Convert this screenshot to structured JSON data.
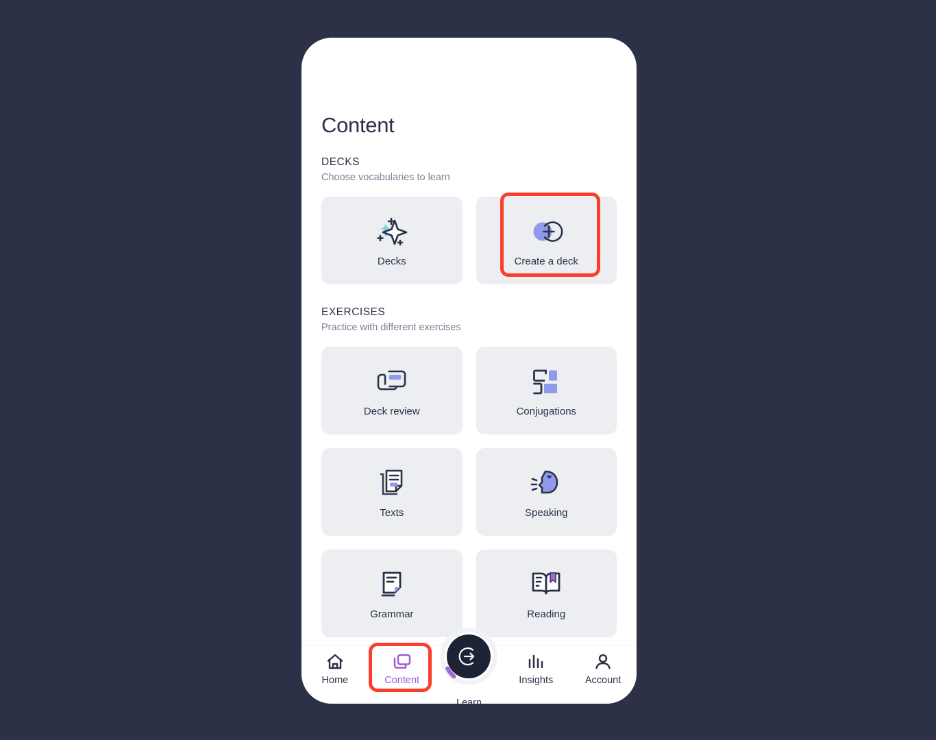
{
  "theme": {
    "page_background": "#2d3148",
    "phone_background": "#ffffff",
    "card_background": "#edeef2",
    "text_primary": "#2d3148",
    "text_secondary": "#7b7f93",
    "accent_purple": "#9b59d0",
    "accent_periwinkle": "#8f9ae8",
    "accent_cyan": "#7ed4e0",
    "annotation_red": "#fc3d2e"
  },
  "page": {
    "title": "Content"
  },
  "sections": [
    {
      "id": "decks",
      "title": "DECKS",
      "subtitle": "Choose vocabularies to learn",
      "cards": [
        {
          "label": "Decks",
          "icon": "sparkle-star-icon"
        },
        {
          "label": "Create a deck",
          "icon": "circle-plus-icon",
          "highlighted": true
        }
      ]
    },
    {
      "id": "exercises",
      "title": "EXERCISES",
      "subtitle": "Practice with different exercises",
      "cards": [
        {
          "label": "Deck review",
          "icon": "stacked-cards-icon"
        },
        {
          "label": "Conjugations",
          "icon": "blocks-grid-icon"
        },
        {
          "label": "Texts",
          "icon": "documents-icon"
        },
        {
          "label": "Speaking",
          "icon": "speaking-head-icon"
        },
        {
          "label": "Grammar",
          "icon": "document-folded-corner-icon"
        },
        {
          "label": "Reading",
          "icon": "open-book-bookmark-icon"
        }
      ]
    }
  ],
  "bottom_nav": {
    "items": [
      {
        "label": "Home",
        "icon": "home-icon",
        "active": false
      },
      {
        "label": "Content",
        "icon": "content-cards-icon",
        "active": true
      },
      {
        "label": "Learn",
        "icon": "arrow-into-circle-icon",
        "active": false
      },
      {
        "label": "Insights",
        "icon": "bar-chart-icon",
        "active": false
      },
      {
        "label": "Account",
        "icon": "person-icon",
        "active": false
      }
    ]
  },
  "annotations": [
    {
      "target": "Create a deck",
      "color": "#fc3d2e"
    },
    {
      "target": "Content",
      "color": "#fc3d2e"
    }
  ]
}
